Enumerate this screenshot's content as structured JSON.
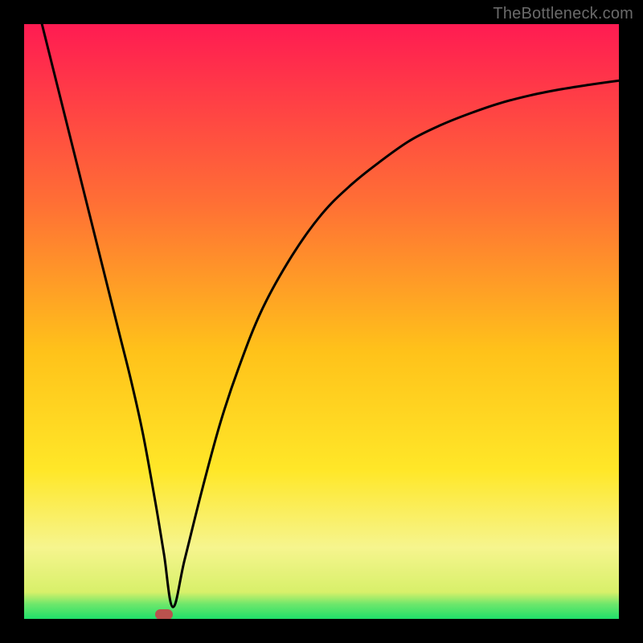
{
  "watermark": "TheBottleneck.com",
  "colors": {
    "frame": "#000000",
    "top": "#ff1b52",
    "mid_upper": "#ff8a2a",
    "mid": "#ffd21a",
    "mid_lower": "#ffee40",
    "pale": "#f6f7a0",
    "green": "#1fe06a",
    "curve": "#000000",
    "marker": "#b9524e",
    "watermark": "#6a6a6a"
  },
  "chart_data": {
    "type": "line",
    "title": "",
    "xlabel": "",
    "ylabel": "",
    "xlim": [
      0,
      100
    ],
    "ylim": [
      0,
      100
    ],
    "grid": false,
    "legend": null,
    "series": [
      {
        "name": "bottleneck-curve",
        "x": [
          3,
          5,
          8,
          10,
          12,
          14,
          16,
          18,
          20,
          22,
          23.5,
          25,
          27,
          30,
          33,
          36,
          40,
          45,
          50,
          55,
          60,
          65,
          70,
          75,
          80,
          85,
          90,
          95,
          100
        ],
        "y": [
          100,
          92,
          80,
          72,
          64,
          56,
          48,
          40,
          31,
          20,
          11,
          2,
          10,
          22,
          33,
          42,
          52,
          61,
          68,
          73,
          77,
          80.5,
          83,
          85,
          86.7,
          88,
          89,
          89.8,
          90.5
        ]
      }
    ],
    "marker": {
      "x": 23.5,
      "y": 0.8
    },
    "gradient_stops": [
      {
        "pos": 0.0,
        "color": "#ff1b52"
      },
      {
        "pos": 0.3,
        "color": "#ff6f35"
      },
      {
        "pos": 0.55,
        "color": "#ffc21a"
      },
      {
        "pos": 0.75,
        "color": "#ffe728"
      },
      {
        "pos": 0.88,
        "color": "#f6f58e"
      },
      {
        "pos": 0.955,
        "color": "#d8f06a"
      },
      {
        "pos": 0.975,
        "color": "#6fe76b"
      },
      {
        "pos": 1.0,
        "color": "#1fe06a"
      }
    ]
  }
}
